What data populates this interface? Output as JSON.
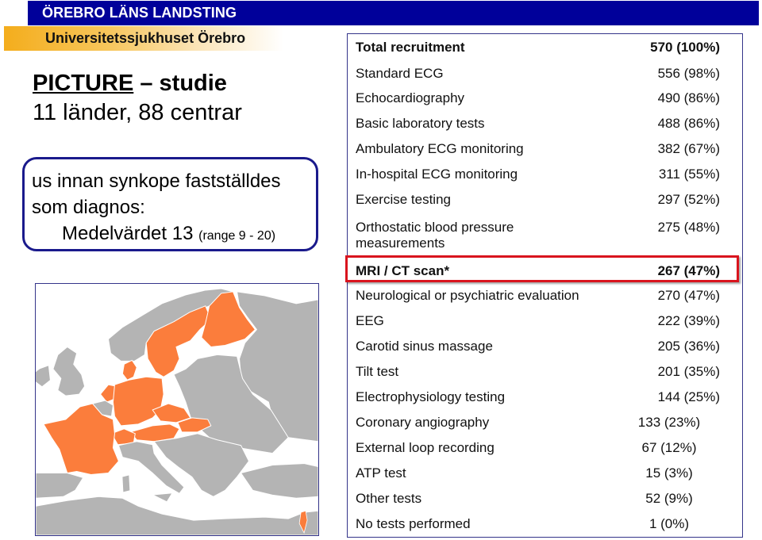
{
  "header": {
    "organization": "ÖREBRO LÄNS LANDSTING",
    "hospital": "Universitetssjukhuset Örebro",
    "colors": {
      "org_bar": "#00009a",
      "hospital_bar": "#f4ad1c"
    }
  },
  "study": {
    "title_underlined": "PICTURE",
    "title_rest": " – studie",
    "subtitle": "11 länder, 88 centrar"
  },
  "info_box": {
    "line1": "us innan synkope fastställdes",
    "line2": "som diagnos:",
    "line3_main": "Medelvärdet 13 ",
    "line3_small": "(range 9 - 20)"
  },
  "map": {
    "description": "Map of Europe with participating countries highlighted",
    "highlighted_countries": [
      "Sweden",
      "Finland",
      "Denmark",
      "Netherlands",
      "Germany",
      "France",
      "Switzerland",
      "Austria",
      "Czech Republic",
      "Slovakia",
      "Israel"
    ],
    "colors": {
      "highlight": "#fb7d3c",
      "land": "#b4b4b4",
      "sea": "#ffffff"
    }
  },
  "table": {
    "rows": [
      {
        "label": "Total recruitment",
        "value": "570 (100%)",
        "bold": true
      },
      {
        "label": "Standard ECG",
        "value": "556 (98%)"
      },
      {
        "label": "Echocardiography",
        "value": "490 (86%)"
      },
      {
        "label": "Basic laboratory tests",
        "value": "488 (86%)"
      },
      {
        "label": "Ambulatory ECG monitoring",
        "value": "382 (67%)"
      },
      {
        "label": "In-hospital ECG monitoring",
        "value": "311 (55%)"
      },
      {
        "label": "Exercise testing",
        "value": "297 (52%)"
      },
      {
        "label": "Orthostatic blood pressure measurements",
        "value": "275 (48%)"
      },
      {
        "label": "MRI / CT scan*",
        "value": "267 (47%)",
        "bold": true,
        "highlighted": true
      },
      {
        "label": "Neurological or psychiatric evaluation",
        "value": "270 (47%)"
      },
      {
        "label": "EEG",
        "value": "222 (39%)"
      },
      {
        "label": "Carotid sinus massage",
        "value": "205 (36%)"
      },
      {
        "label": "Tilt test",
        "value": "201 (35%)"
      },
      {
        "label": "Electrophysiology testing",
        "value": "144 (25%)"
      },
      {
        "label": "Coronary angiography",
        "value": "133 (23%)"
      },
      {
        "label": "External loop recording",
        "value": "67 (12%)"
      },
      {
        "label": "ATP test",
        "value": "15 (3%)"
      },
      {
        "label": "Other tests",
        "value": "52 (9%)"
      },
      {
        "label": "No tests performed",
        "value": "1 (0%)"
      }
    ],
    "colors": {
      "border": "#34348a",
      "highlight_border": "#d9141e"
    }
  }
}
